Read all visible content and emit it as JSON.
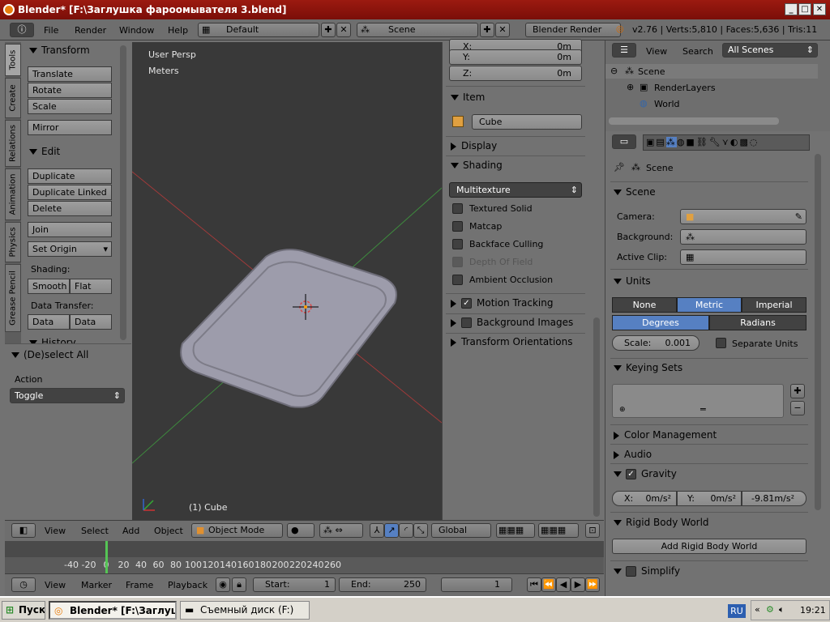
{
  "window": {
    "title": "Blender* [F:\\Заглушка фароомывателя 3.blend]"
  },
  "menubar": {
    "items": [
      "File",
      "Render",
      "Window",
      "Help"
    ],
    "layout": "Default",
    "scene": "Scene",
    "engine": "Blender Render",
    "info": "v2.76 | Verts:5,810 | Faces:5,636 | Tris:11"
  },
  "tool_tabs": [
    "Tools",
    "Create",
    "Relations",
    "Animation",
    "Physics",
    "Grease Pencil"
  ],
  "tools": {
    "transform_header": "Transform",
    "translate": "Translate",
    "rotate": "Rotate",
    "scale": "Scale",
    "mirror": "Mirror",
    "edit_header": "Edit",
    "duplicate": "Duplicate",
    "duplicate_linked": "Duplicate Linked",
    "delete": "Delete",
    "join": "Join",
    "set_origin": "Set Origin",
    "shading_label": "Shading:",
    "smooth": "Smooth",
    "flat": "Flat",
    "data_transfer_label": "Data Transfer:",
    "data": "Data",
    "data_lay": "Data Lay",
    "history_header": "History"
  },
  "operator": {
    "header": "(De)select All",
    "action_label": "Action",
    "action_value": "Toggle"
  },
  "viewport": {
    "view_name": "User Persp",
    "units": "Meters",
    "object_label": "(1) Cube"
  },
  "npanel": {
    "x_label": "X:",
    "x_value": "0m",
    "y_label": "Y:",
    "y_value": "0m",
    "z_label": "Z:",
    "z_value": "0m",
    "item_header": "Item",
    "item_name": "Cube",
    "display_header": "Display",
    "shading_header": "Shading",
    "shading_mode": "Multitexture",
    "textured_solid": "Textured Solid",
    "matcap": "Matcap",
    "backface_culling": "Backface Culling",
    "depth_of_field": "Depth Of Field",
    "ambient_occlusion": "Ambient Occlusion",
    "motion_tracking": "Motion Tracking",
    "background_images": "Background Images",
    "transform_orientations": "Transform Orientations"
  },
  "view3d_header": {
    "view": "View",
    "select": "Select",
    "add": "Add",
    "object": "Object",
    "mode": "Object Mode",
    "orientation": "Global"
  },
  "timeline": {
    "ticks": [
      "-40",
      "-20",
      "0",
      "20",
      "40",
      "60",
      "80",
      "100",
      "120",
      "140",
      "160",
      "180",
      "200",
      "220",
      "240",
      "260"
    ],
    "current_frame_marker": 0,
    "view": "View",
    "marker": "Marker",
    "frame": "Frame",
    "playback": "Playback",
    "start_label": "Start:",
    "start": "1",
    "end_label": "End:",
    "end": "250",
    "current": "1"
  },
  "outliner": {
    "view": "View",
    "search": "Search",
    "filter": "All Scenes",
    "scene": "Scene",
    "render_layers": "RenderLayers",
    "world": "World"
  },
  "properties": {
    "context": "Scene",
    "scene_header": "Scene",
    "camera_label": "Camera:",
    "background_label": "Background:",
    "active_clip_label": "Active Clip:",
    "units_header": "Units",
    "unit_none": "None",
    "unit_metric": "Metric",
    "unit_imperial": "Imperial",
    "degrees": "Degrees",
    "radians": "Radians",
    "scale_label": "Scale:",
    "scale_value": "0.001",
    "separate_units": "Separate Units",
    "keying_sets_header": "Keying Sets",
    "color_management": "Color Management",
    "audio": "Audio",
    "gravity": "Gravity",
    "gx_label": "X:",
    "gx": "0m/s²",
    "gy_label": "Y:",
    "gy": "0m/s²",
    "gz": "-9.81m/s²",
    "rigid_body_world": "Rigid Body World",
    "add_rigid_body_world": "Add Rigid Body World",
    "simplify": "Simplify"
  },
  "taskbar": {
    "start": "Пуск",
    "task_blender": "Blender* [F:\\Заглуш...",
    "task_disk": "Съемный диск (F:)",
    "lang": "RU",
    "clock": "19:21"
  }
}
